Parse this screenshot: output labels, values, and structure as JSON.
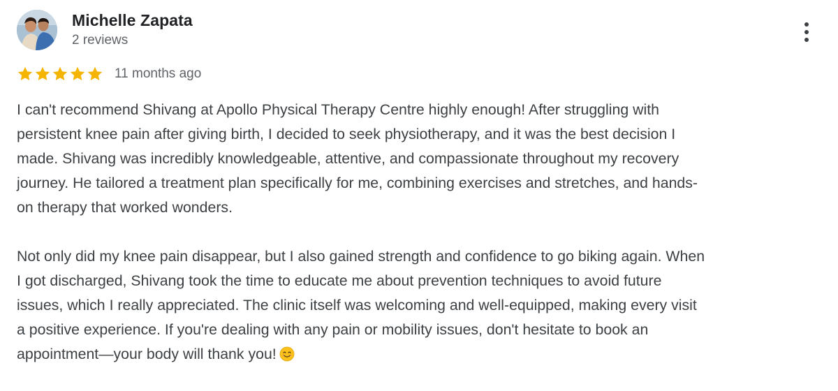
{
  "reviewer": {
    "name": "Michelle Zapata",
    "review_count": "2 reviews",
    "avatar_icon": "profile-photo"
  },
  "menu": {
    "icon": "more-vert-icon"
  },
  "rating": {
    "stars": 5,
    "max_stars": 5,
    "star_color": "#f4b400",
    "date": "11 months ago"
  },
  "review": {
    "paragraph_1": "I can't recommend Shivang at Apollo Physical Therapy Centre highly enough! After struggling with\npersistent knee pain after giving birth, I decided to seek physiotherapy, and it was the best decision I\nmade. Shivang was incredibly knowledgeable, attentive, and compassionate throughout my recovery\njourney. He tailored a treatment plan specifically for me, combining exercises and stretches, and hands-\non therapy that worked wonders.",
    "paragraph_2": "Not only did my knee pain disappear, but I also gained strength and confidence to go biking again. When\nI got discharged, Shivang took the time to educate me about prevention techniques to avoid future\nissues, which I really appreciated. The clinic itself was welcoming and well-equipped, making every visit\na positive experience. If you're dealing with any pain or mobility issues, don't hesitate to book an\nappointment—your body will thank you!",
    "emoji": "smiling-face-icon"
  }
}
